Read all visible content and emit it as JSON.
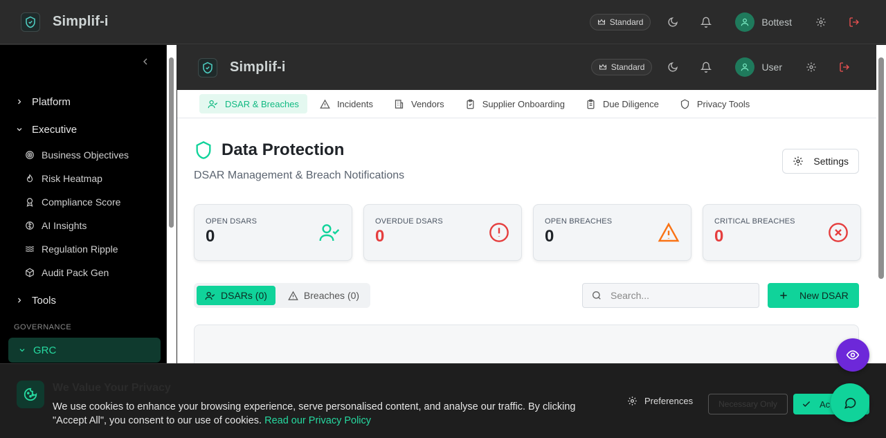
{
  "app": {
    "name": "Simplif-i",
    "plan": "Standard",
    "user": "Bottest"
  },
  "inner_app": {
    "name": "Simplif-i",
    "plan": "Standard",
    "user": "User"
  },
  "sidebar": {
    "groups_top": [
      {
        "label": "Platform",
        "expanded": false
      },
      {
        "label": "Executive",
        "expanded": true
      }
    ],
    "executive_items": [
      {
        "label": "Business Objectives",
        "icon": "target-icon"
      },
      {
        "label": "Risk Heatmap",
        "icon": "flame-icon"
      },
      {
        "label": "Compliance Score",
        "icon": "award-icon"
      },
      {
        "label": "AI Insights",
        "icon": "brain-icon"
      },
      {
        "label": "Regulation Ripple",
        "icon": "waves-icon"
      },
      {
        "label": "Audit Pack Gen",
        "icon": "package-icon"
      }
    ],
    "tools_label": "Tools",
    "section_label": "GOVERNANCE",
    "active_group": "GRC"
  },
  "subnav": {
    "tabs": [
      {
        "label": "DSAR & Breaches",
        "icon": "user-check-icon",
        "active": true
      },
      {
        "label": "Incidents",
        "icon": "alert-triangle-icon",
        "active": false
      },
      {
        "label": "Vendors",
        "icon": "building-icon",
        "active": false
      },
      {
        "label": "Supplier Onboarding",
        "icon": "clipboard-icon",
        "active": false
      },
      {
        "label": "Due Diligence",
        "icon": "clipboard-list-icon",
        "active": false
      },
      {
        "label": "Privacy Tools",
        "icon": "shield-icon",
        "active": false
      }
    ]
  },
  "page": {
    "title": "Data Protection",
    "subtitle": "DSAR Management & Breach Notifications",
    "settings_label": "Settings"
  },
  "stats": [
    {
      "label": "OPEN DSARS",
      "value": "0",
      "color": "#1f2328",
      "icon": "user-check-icon"
    },
    {
      "label": "OVERDUE DSARS",
      "value": "0",
      "color": "#e53e3e",
      "icon": "alert-circle-icon"
    },
    {
      "label": "OPEN BREACHES",
      "value": "0",
      "color": "#1f2328",
      "icon": "alert-triangle-icon"
    },
    {
      "label": "CRITICAL BREACHES",
      "value": "0",
      "color": "#e53e3e",
      "icon": "x-circle-icon"
    }
  ],
  "list_tabs": {
    "dsars": "DSARs (0)",
    "breaches": "Breaches (0)"
  },
  "search": {
    "placeholder": "Search..."
  },
  "new_button": "New DSAR",
  "cookie": {
    "title": "We Value Your Privacy",
    "text": "We use cookies to enhance your browsing experience, serve personalised content, and analyse our traffic. By clicking \"Accept All\", you consent to our use of cookies.",
    "link": "Read our Privacy Policy",
    "preferences": "Preferences",
    "necessary": "Necessary Only",
    "accept": "Ac"
  },
  "colors": {
    "accent": "#10d39a",
    "danger": "#e53e3e",
    "warning": "#f97316"
  }
}
